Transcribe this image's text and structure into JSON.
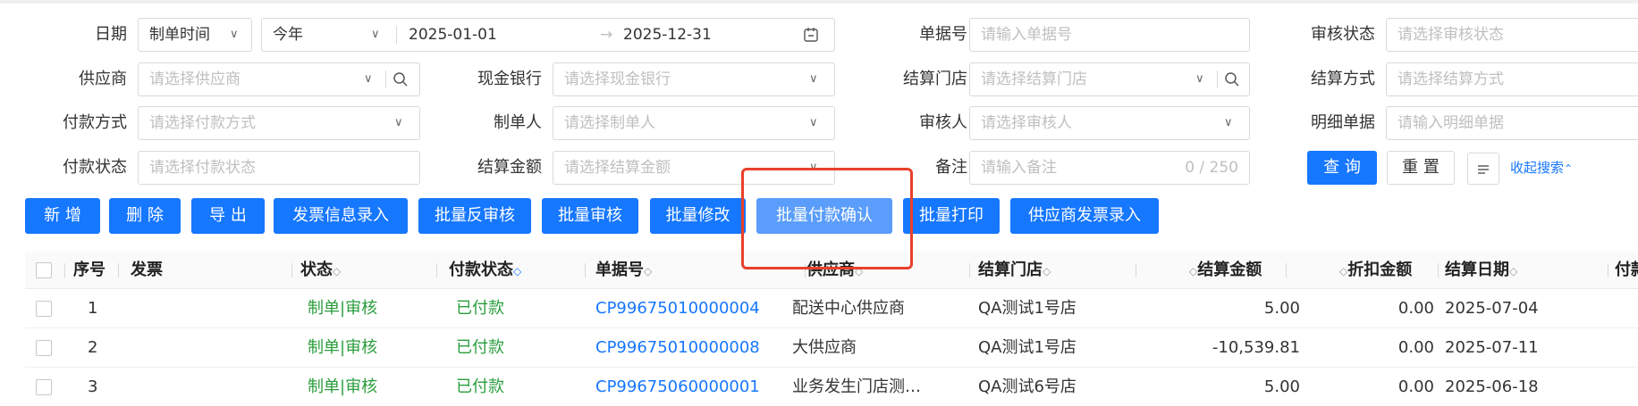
{
  "filters": {
    "date_label": "日期",
    "date_type": "制单时间",
    "date_range_preset": "今年",
    "date_start": "2025-01-01",
    "date_arrow": "→",
    "date_end": "2025-12-31",
    "doc_no_label": "单据号",
    "doc_no_placeholder": "请输入单据号",
    "audit_status_label": "审核状态",
    "audit_status_placeholder": "请选择审核状态",
    "supplier_label": "供应商",
    "supplier_placeholder": "请选择供应商",
    "bank_label": "现金银行",
    "bank_placeholder": "请选择现金银行",
    "store_label": "结算门店",
    "store_placeholder": "请选择结算门店",
    "settle_method_label": "结算方式",
    "settle_method_placeholder": "请选择结算方式",
    "pay_method_label": "付款方式",
    "pay_method_placeholder": "请选择付款方式",
    "creator_label": "制单人",
    "creator_placeholder": "请选择制单人",
    "auditor_label": "审核人",
    "auditor_placeholder": "请选择审核人",
    "detail_label": "明细单据",
    "detail_placeholder": "请输入明细单据",
    "pay_status_label": "付款状态",
    "pay_status_placeholder": "请选择付款状态",
    "amount_label": "结算金额",
    "amount_placeholder": "请选择结算金额",
    "remark_label": "备注",
    "remark_placeholder": "请输入备注",
    "remark_count": "0 / 250",
    "query_button": "查 询",
    "reset_button": "重 置",
    "collapse_link": "收起搜索"
  },
  "toolbar": [
    "新 增",
    "删 除",
    "导 出",
    "发票信息录入",
    "批量反审核",
    "批量审核",
    "批量修改",
    "批量付款确认",
    "批量打印",
    "供应商发票录入"
  ],
  "table": {
    "headers": {
      "seq": "序号",
      "invoice": "发票",
      "status": "状态",
      "pay_status": "付款状态",
      "doc_no": "单据号",
      "supplier": "供应商",
      "store": "结算门店",
      "amount": "结算金额",
      "discount": "折扣金额",
      "date": "结算日期",
      "next": "付款"
    },
    "rows": [
      {
        "seq": "1",
        "status": "制单|审核",
        "pay_status": "已付款",
        "doc_no": "CP99675010000004",
        "supplier": "配送中心供应商",
        "store": "QA测试1号店",
        "amount": "5.00",
        "discount": "0.00",
        "date": "2025-07-04"
      },
      {
        "seq": "2",
        "status": "制单|审核",
        "pay_status": "已付款",
        "doc_no": "CP99675010000008",
        "supplier": "大供应商",
        "store": "QA测试1号店",
        "amount": "-10,539.81",
        "discount": "0.00",
        "date": "2025-07-11"
      },
      {
        "seq": "3",
        "status": "制单|审核",
        "pay_status": "已付款",
        "doc_no": "CP99675060000001",
        "supplier": "业务发生门店测…",
        "store": "QA测试6号店",
        "amount": "5.00",
        "discount": "0.00",
        "date": "2025-06-18"
      }
    ]
  },
  "colors": {
    "primary": "#1677ff",
    "highlight": "#e8412c",
    "status_green": "#2a9d3c"
  }
}
